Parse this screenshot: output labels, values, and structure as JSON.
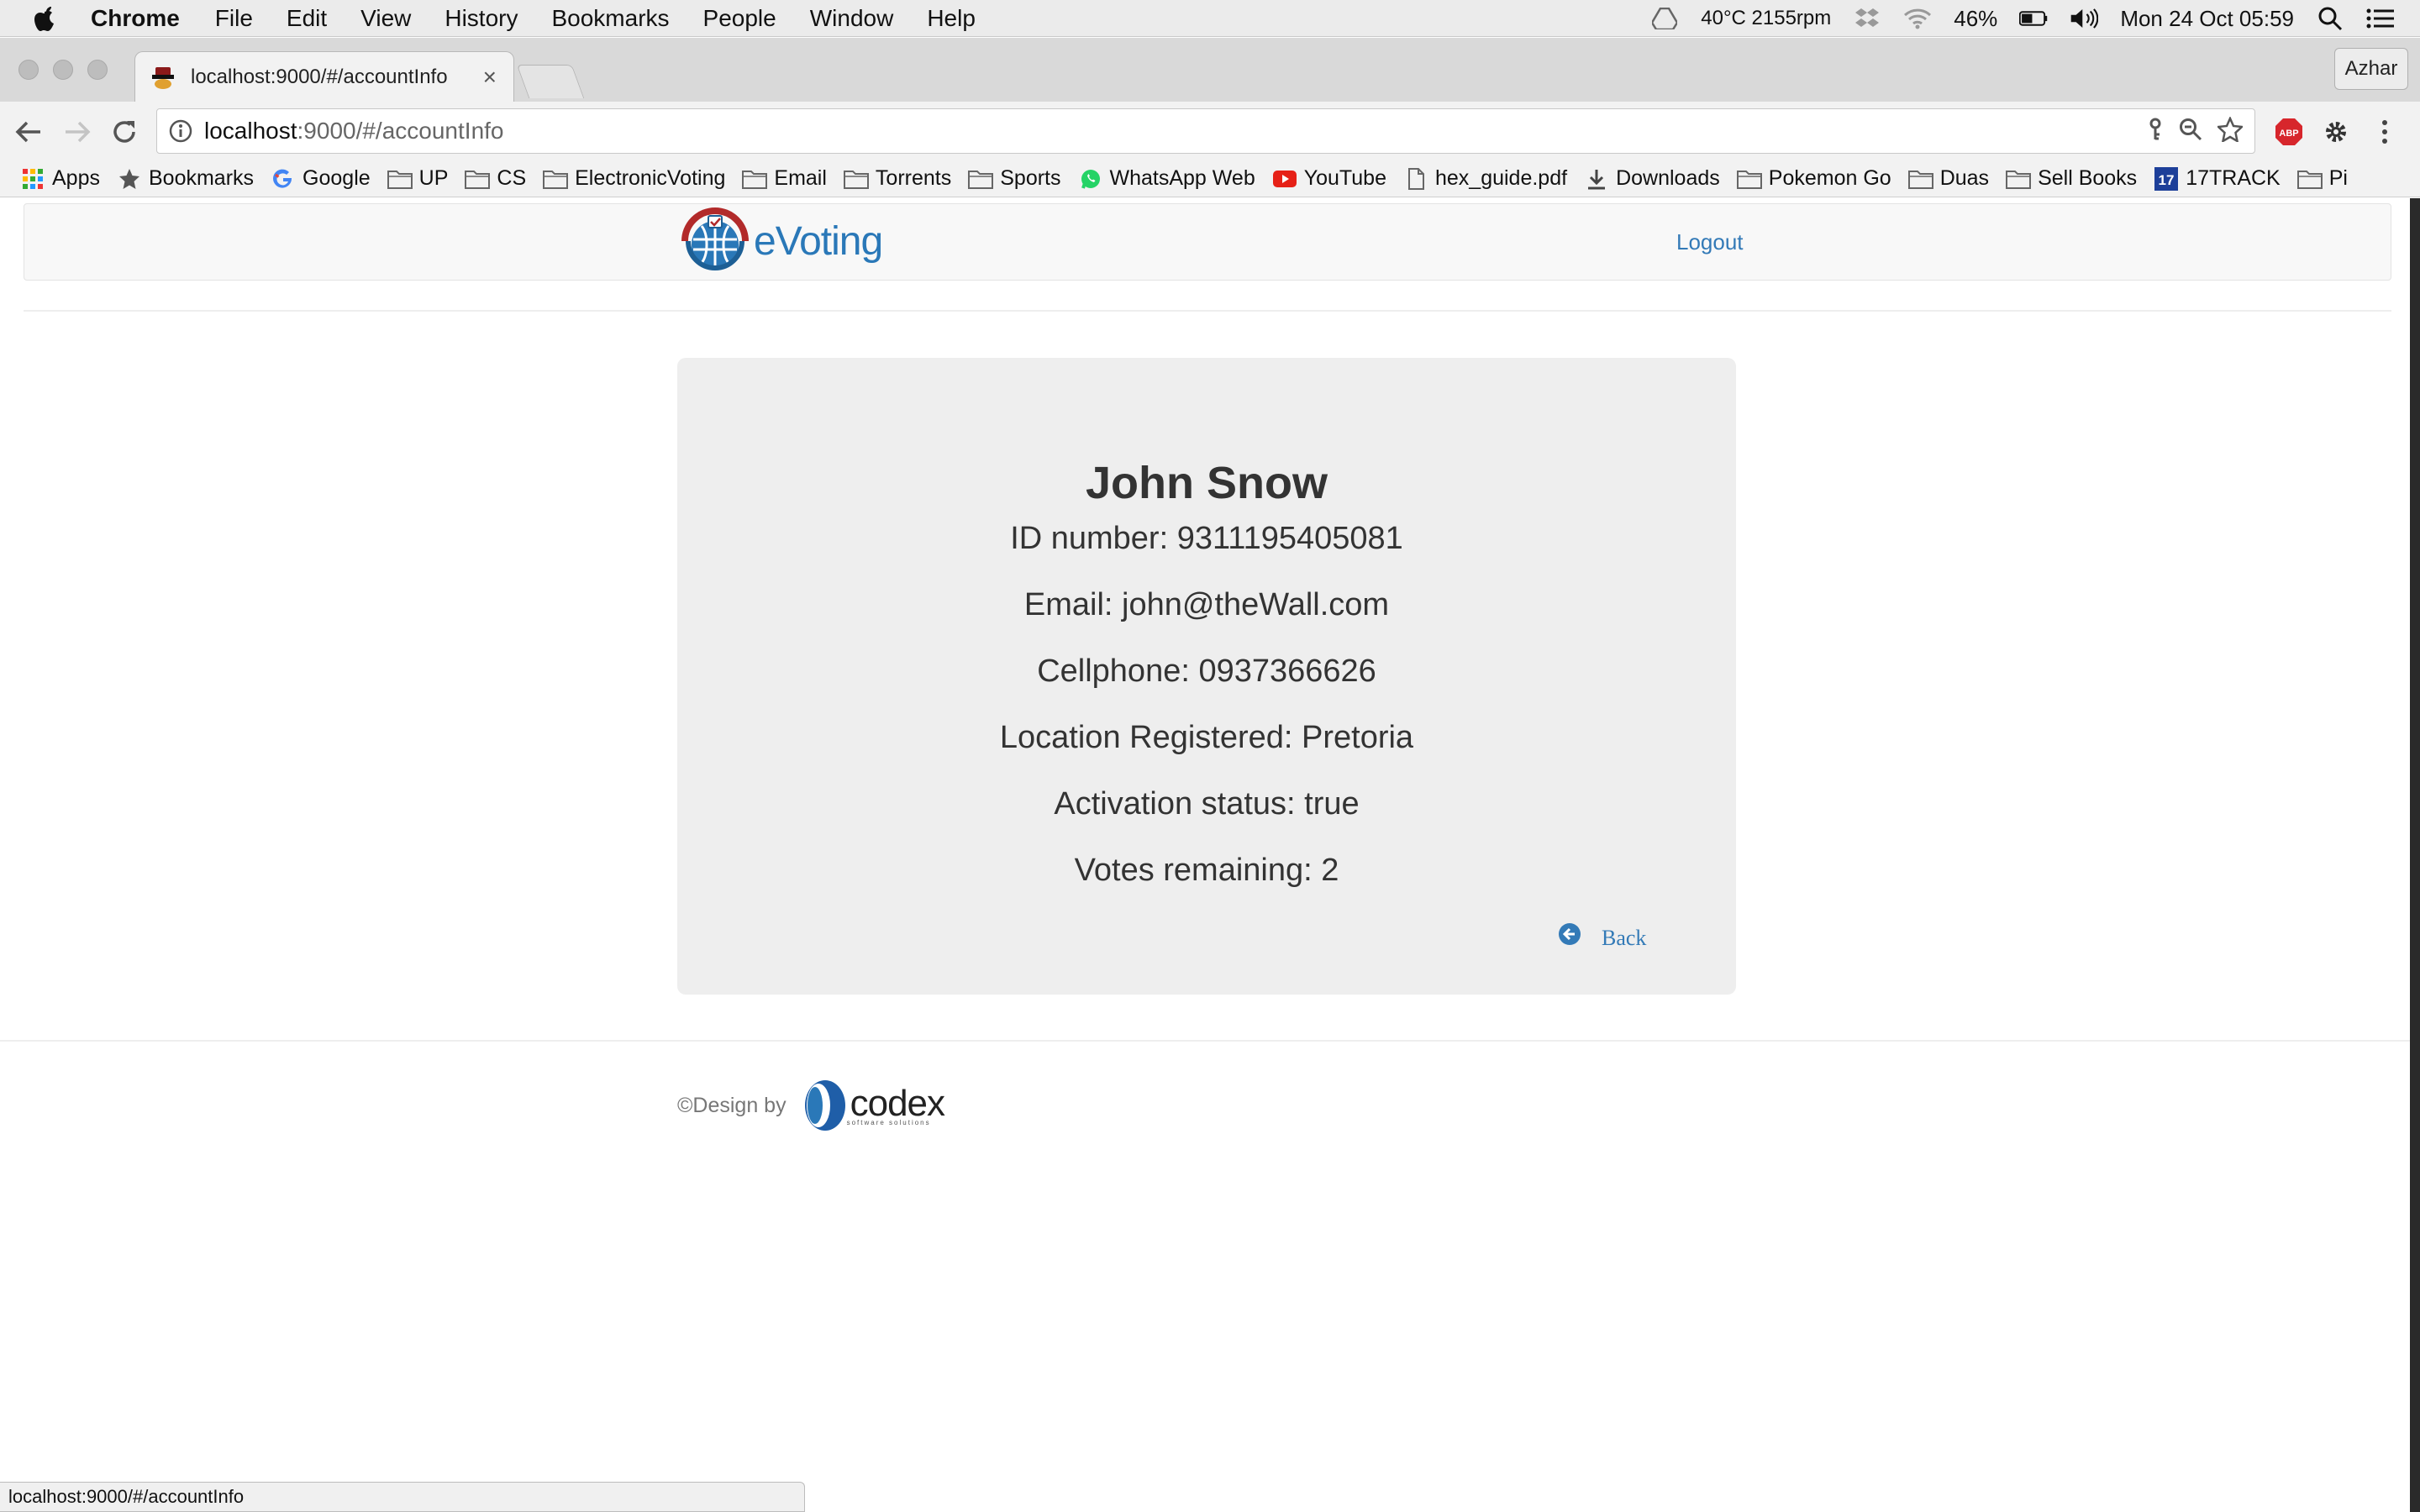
{
  "menubar": {
    "app_name": "Chrome",
    "items": [
      "File",
      "Edit",
      "View",
      "History",
      "Bookmarks",
      "People",
      "Window",
      "Help"
    ],
    "temperature": "40°C 2155rpm",
    "battery": "46%",
    "datetime": "Mon 24 Oct  05:59"
  },
  "tabs": {
    "active_title": "localhost:9000/#/accountInfo",
    "close_glyph": "×",
    "profile_name": "Azhar"
  },
  "omnibox": {
    "host": "localhost",
    "path": ":9000/#/accountInfo"
  },
  "bookmarks": [
    {
      "label": "Apps",
      "icon": "apps-grid-icon"
    },
    {
      "label": "Bookmarks",
      "icon": "star-icon"
    },
    {
      "label": "Google",
      "icon": "google-icon"
    },
    {
      "label": "UP",
      "icon": "folder-icon"
    },
    {
      "label": "CS",
      "icon": "folder-icon"
    },
    {
      "label": "ElectronicVoting",
      "icon": "folder-icon"
    },
    {
      "label": "Email",
      "icon": "folder-icon"
    },
    {
      "label": "Torrents",
      "icon": "folder-icon"
    },
    {
      "label": "Sports",
      "icon": "folder-icon"
    },
    {
      "label": "WhatsApp Web",
      "icon": "whatsapp-icon"
    },
    {
      "label": "YouTube",
      "icon": "youtube-icon"
    },
    {
      "label": "hex_guide.pdf",
      "icon": "file-icon"
    },
    {
      "label": "Downloads",
      "icon": "download-icon"
    },
    {
      "label": "Pokemon Go",
      "icon": "folder-icon"
    },
    {
      "label": "Duas",
      "icon": "folder-icon"
    },
    {
      "label": "Sell Books",
      "icon": "folder-icon"
    },
    {
      "label": "17TRACK",
      "icon": "17track-icon"
    },
    {
      "label": "Pi",
      "icon": "folder-icon"
    }
  ],
  "navbar": {
    "brand_text": "eVoting",
    "logout_label": "Logout"
  },
  "account": {
    "name": "John Snow",
    "id_line": "ID number: 9311195405081",
    "email_line": "Email: john@theWall.com",
    "cellphone_line": "Cellphone: 0937366626",
    "location_line": "Location Registered: Pretoria",
    "activation_line": "Activation status: true",
    "votes_line": "Votes remaining: 2",
    "back_label": "Back"
  },
  "footer": {
    "design_by": "©Design by",
    "logo_text": "codex",
    "logo_tagline": "software solutions"
  },
  "statusbar": {
    "url": "localhost:9000/#/accountInfo"
  },
  "colors": {
    "link": "#337ab7",
    "card_bg": "#eeeeee",
    "brand_blue": "#2a78b8",
    "brand_red": "#b22a2a"
  }
}
